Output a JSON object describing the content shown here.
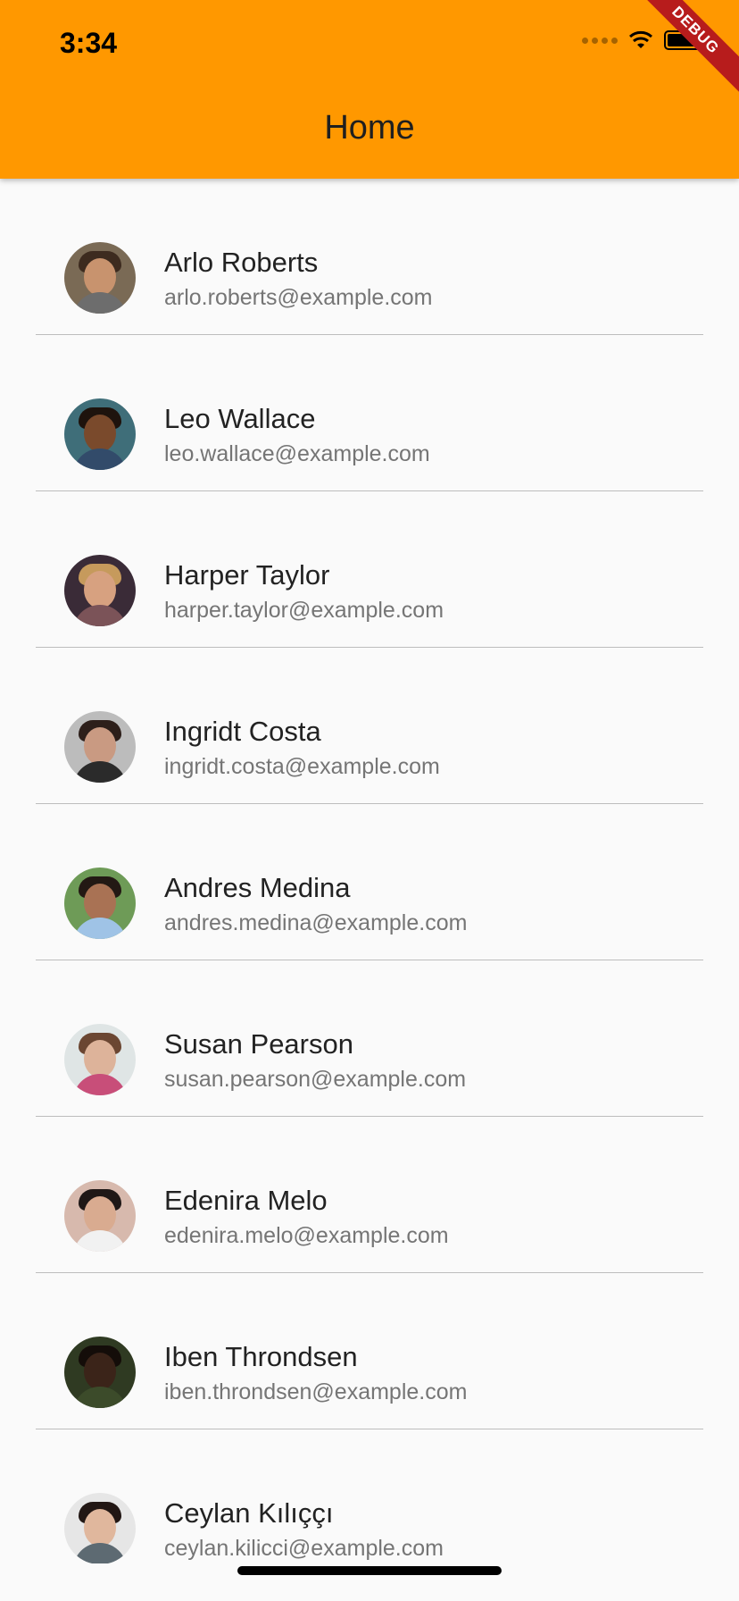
{
  "status_bar": {
    "time": "3:34"
  },
  "app_bar": {
    "title": "Home",
    "background_color": "#ff9800"
  },
  "debug_banner": "DEBUG",
  "list": {
    "items": [
      {
        "name": "Arlo Roberts",
        "email": "arlo.roberts@example.com"
      },
      {
        "name": "Leo Wallace",
        "email": "leo.wallace@example.com"
      },
      {
        "name": "Harper Taylor",
        "email": "harper.taylor@example.com"
      },
      {
        "name": "Ingridt Costa",
        "email": "ingridt.costa@example.com"
      },
      {
        "name": "Andres Medina",
        "email": "andres.medina@example.com"
      },
      {
        "name": "Susan Pearson",
        "email": "susan.pearson@example.com"
      },
      {
        "name": "Edenira Melo",
        "email": "edenira.melo@example.com"
      },
      {
        "name": "Iben Throndsen",
        "email": "iben.throndsen@example.com"
      },
      {
        "name": "Ceylan Kılıççı",
        "email": "ceylan.kilicci@example.com"
      }
    ]
  }
}
